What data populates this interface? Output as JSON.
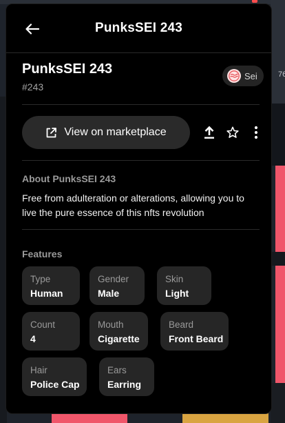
{
  "backdrop": {
    "edge_text": "76"
  },
  "header": {
    "title": "PunksSEI 243",
    "back_icon": "arrow-left-icon"
  },
  "nft": {
    "name": "PunksSEI 243",
    "id": "#243"
  },
  "chain": {
    "label": "Sei",
    "icon": "sei-logo-icon",
    "color": "#e8585e"
  },
  "actions": {
    "marketplace_label": "View on marketplace",
    "marketplace_icon": "external-link-icon",
    "share_icon": "upload-icon",
    "favorite_icon": "star-icon",
    "more_icon": "more-vertical-icon"
  },
  "about": {
    "title": "About PunksSEI 243",
    "text": "Free from adulteration or alterations, allowing you to live the pure essence of this nfts revolution"
  },
  "features": {
    "title": "Features",
    "items": [
      {
        "key": "Type",
        "value": "Human"
      },
      {
        "key": "Gender",
        "value": "Male"
      },
      {
        "key": "Skin",
        "value": "Light"
      },
      {
        "key": "Count",
        "value": "4"
      },
      {
        "key": "Mouth",
        "value": "Cigarette"
      },
      {
        "key": "Beard",
        "value": "Front Beard"
      },
      {
        "key": "Hair",
        "value": "Police Cap"
      },
      {
        "key": "Ears",
        "value": "Earring"
      }
    ]
  }
}
